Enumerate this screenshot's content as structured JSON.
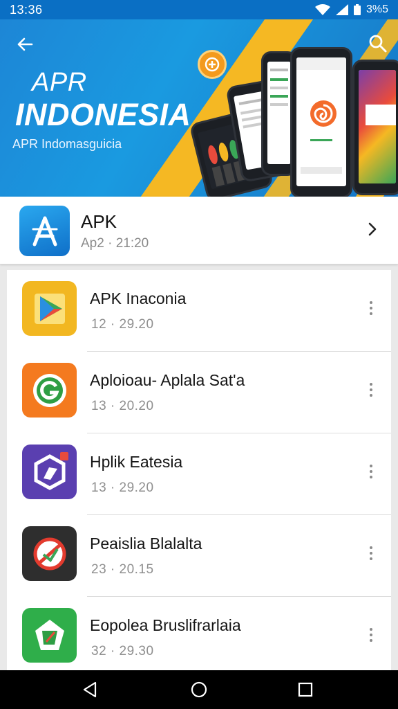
{
  "status_bar": {
    "time": "13:36",
    "battery_text": "3%5"
  },
  "hero": {
    "title_line1": "APR",
    "title_line2": "INDONESIA",
    "subtitle": "APR Indomasguicia",
    "colors": {
      "background": "#1a8bd8",
      "accent": "#f5b823"
    }
  },
  "featured": {
    "name": "APK",
    "subtitle": "Ap2 · 21:20"
  },
  "apps": [
    {
      "title": "APK Inaconia",
      "subtitle": "12 · 29.20",
      "icon": "play-store-icon",
      "color": "#f2b721"
    },
    {
      "title": "Aploioau- Aplala Sat'a",
      "subtitle": "13 · 20.20",
      "icon": "g-circle-icon",
      "color": "#f47a1f"
    },
    {
      "title": "Hplik Eatesia",
      "subtitle": "13 · 29.20",
      "icon": "hexagon-icon",
      "color": "#5a3fb0"
    },
    {
      "title": "Peaislia Blalalta",
      "subtitle": "23 · 20.15",
      "icon": "prohibited-icon",
      "color": "#2e2e2e"
    },
    {
      "title": "Eopolea Bruslifrarlaia",
      "subtitle": "32 · 29.30",
      "icon": "gem-icon",
      "color": "#2fae4a"
    }
  ]
}
